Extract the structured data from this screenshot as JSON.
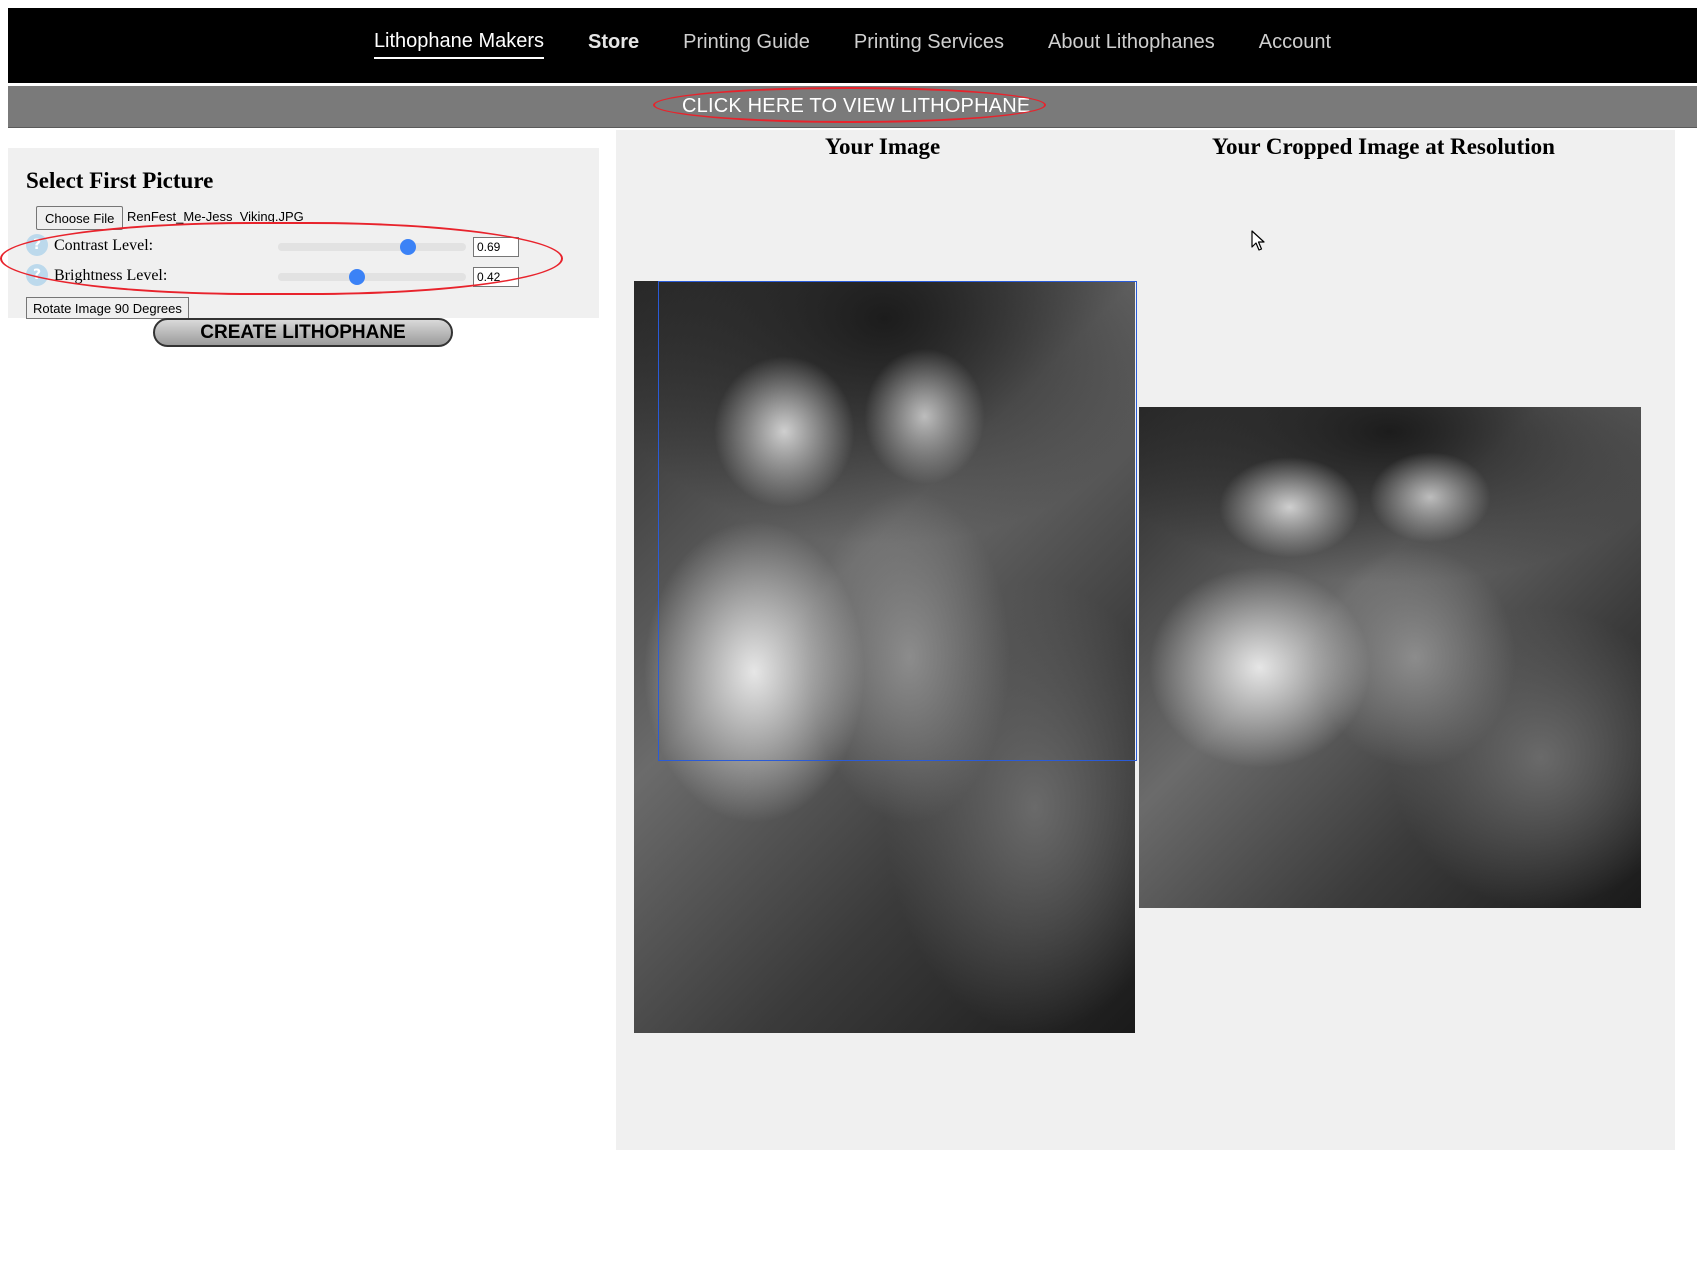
{
  "nav": {
    "items": [
      {
        "label": "Lithophane Makers"
      },
      {
        "label": "Store"
      },
      {
        "label": "Printing Guide"
      },
      {
        "label": "Printing Services"
      },
      {
        "label": "About Lithophanes"
      },
      {
        "label": "Account"
      }
    ],
    "active_label": "Lithophane Makers"
  },
  "banner": {
    "link_text": "CLICK HERE TO VIEW LITHOPHANE"
  },
  "controls": {
    "title": "Select First Picture",
    "choose_file_label": "Choose File",
    "file_name": "RenFest_Me-Jess_Viking.JPG",
    "contrast": {
      "label": "Contrast Level:",
      "value": "0.69",
      "fraction": 0.69
    },
    "brightness": {
      "label": "Brightness Level:",
      "value": "0.42",
      "fraction": 0.42
    },
    "help_glyph": "?",
    "rotate_label": "Rotate Image 90 Degrees",
    "create_label": "CREATE LITHOPHANE"
  },
  "preview": {
    "your_image_title": "Your Image",
    "cropped_title": "Your Cropped Image at Resolution"
  },
  "icons": {
    "help": "question-circle-icon",
    "cursor": "mouse-pointer-icon"
  },
  "colors": {
    "nav_bg": "#000000",
    "banner_bg": "#7a7a7a",
    "annotation_red": "#e8232c",
    "slider_thumb": "#3b82f6",
    "panel_bg": "#f0f0f0"
  }
}
